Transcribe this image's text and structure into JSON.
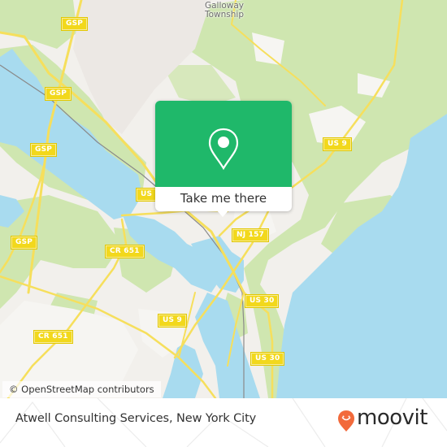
{
  "map": {
    "place_labels": [
      {
        "text": "Galloway Township"
      }
    ],
    "road_shields": [
      {
        "id": "gsp-1",
        "text": "GSP"
      },
      {
        "id": "gsp-2",
        "text": "GSP"
      },
      {
        "id": "gsp-3",
        "text": "GSP"
      },
      {
        "id": "gsp-4",
        "text": "GSP"
      },
      {
        "id": "us9-north",
        "text": "US 9"
      },
      {
        "id": "us-west",
        "text": "US"
      },
      {
        "id": "nj157",
        "text": "NJ 157"
      },
      {
        "id": "cr651-north",
        "text": "CR 651"
      },
      {
        "id": "cr651-south",
        "text": "CR 651"
      },
      {
        "id": "us9-south",
        "text": "US 9"
      },
      {
        "id": "us30-north",
        "text": "US 30"
      },
      {
        "id": "us30-south",
        "text": "US 30"
      }
    ],
    "colors": {
      "land": "#f2f0ec",
      "green": "#cfe6b0",
      "water": "#a8dbef",
      "road": "#f6df5c",
      "popup": "#1fb86a"
    },
    "attribution": "© OpenStreetMap contributors"
  },
  "popup": {
    "icon": "map-pin-icon",
    "action_label": "Take me there"
  },
  "footer": {
    "place_name": "Atwell Consulting Services, New York City",
    "brand": "moovit",
    "brand_icon": "moovit-pin-logo-icon",
    "brand_color": "#f26a3b"
  }
}
